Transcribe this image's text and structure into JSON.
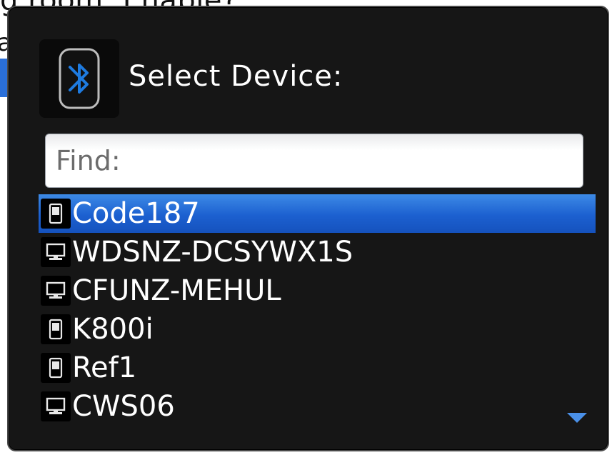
{
  "background": {
    "title_fragment": "g room: Enable?"
  },
  "dialog": {
    "icon": "bluetooth-icon",
    "title": "Select Device:",
    "search": {
      "placeholder": "Find:",
      "value": ""
    },
    "selected_index": 0,
    "devices": [
      {
        "name": "Code187",
        "icon": "phone-icon"
      },
      {
        "name": "WDSNZ-DCSYWX1S",
        "icon": "computer-icon"
      },
      {
        "name": "CFUNZ-MEHUL",
        "icon": "computer-icon"
      },
      {
        "name": "K800i",
        "icon": "phone-icon"
      },
      {
        "name": "Ref1",
        "icon": "phone-icon"
      },
      {
        "name": "CWS06",
        "icon": "computer-icon"
      }
    ],
    "scroll_indicator": "scroll-down-arrow-icon"
  },
  "colors": {
    "dialog_background": "#161616",
    "selection_blue": "#1c60d0",
    "bluetooth_blue": "#1e7be0",
    "scroll_arrow": "#4a90e8"
  }
}
